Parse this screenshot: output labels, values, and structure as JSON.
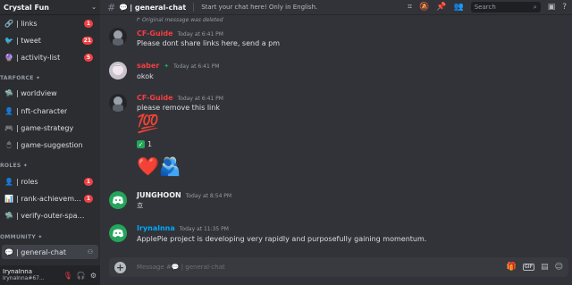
{
  "server": {
    "name": "Crystal Fun"
  },
  "sidebar": {
    "channels_top": [
      {
        "label": "| links",
        "badge": "1",
        "icon": "link-icon",
        "glyph": "🔗"
      },
      {
        "label": "| tweet",
        "badge": "21",
        "icon": "bird-icon",
        "glyph": "🐦"
      },
      {
        "label": "| activity-list",
        "badge": "5",
        "icon": "list-icon",
        "glyph": "🔮"
      }
    ],
    "category_1": "TARFORCE ✦",
    "channels_mid": [
      {
        "label": "| worldview",
        "icon": "ufo-icon",
        "glyph": "🛸"
      },
      {
        "label": "| nft-character",
        "icon": "character-icon",
        "glyph": "👤"
      },
      {
        "label": "| game-strategy",
        "icon": "gamepad-icon",
        "glyph": "🎮"
      },
      {
        "label": "| game-suggestion",
        "icon": "mouse-icon",
        "glyph": "🖱"
      }
    ],
    "category_2": "ROLES ✦",
    "channels_roles": [
      {
        "label": "| roles",
        "badge": "1",
        "icon": "person-icon",
        "glyph": "👤"
      },
      {
        "label": "| rank-achievem...",
        "badge": "1",
        "icon": "chart-icon",
        "glyph": "📊"
      },
      {
        "label": "| verify-outer-space...",
        "icon": "ufo-icon",
        "glyph": "🛸"
      }
    ],
    "category_3": "OMMUNITY ✦",
    "active_channel": {
      "label": "| general-chat",
      "icon": "chat-icon",
      "glyph": "💬"
    }
  },
  "user": {
    "name": "IrynaInna",
    "tag": "IrynaInna#67..."
  },
  "topbar": {
    "channel": "| general-chat",
    "topic": "Start your chat here! Only in English.",
    "search_placeholder": "Search"
  },
  "messages": {
    "deleted_note": "Original message was deleted",
    "m1": {
      "author": "CF-Guide",
      "time": "Today at 6:41 PM",
      "text": "Please dont share links here, send a pm",
      "color": "#f23f43"
    },
    "m2": {
      "author": "saber",
      "time": "Today at 6:41 PM",
      "text": "okok",
      "color": "#f23f43"
    },
    "m3": {
      "author": "CF-Guide",
      "time": "Today at 6:41 PM",
      "text": "please remove this link",
      "color": "#f23f43"
    },
    "m3_emoji": "💯",
    "m3_reaction_count": "1",
    "m3_big_emojis": "❤️🫂",
    "m4": {
      "author": "JUNGHOON",
      "time": "Today at 8:54 PM",
      "text": "흐",
      "color": "#f2f3f5"
    },
    "m5": {
      "author": "Irynalnna",
      "time": "Today at 11:35 PM",
      "text": "ApplePie project is developing very rapidly and purposefully   gaining momentum.",
      "color": "#00a8fc"
    }
  },
  "composer": {
    "placeholder": "Message #💬 | general-chat"
  }
}
